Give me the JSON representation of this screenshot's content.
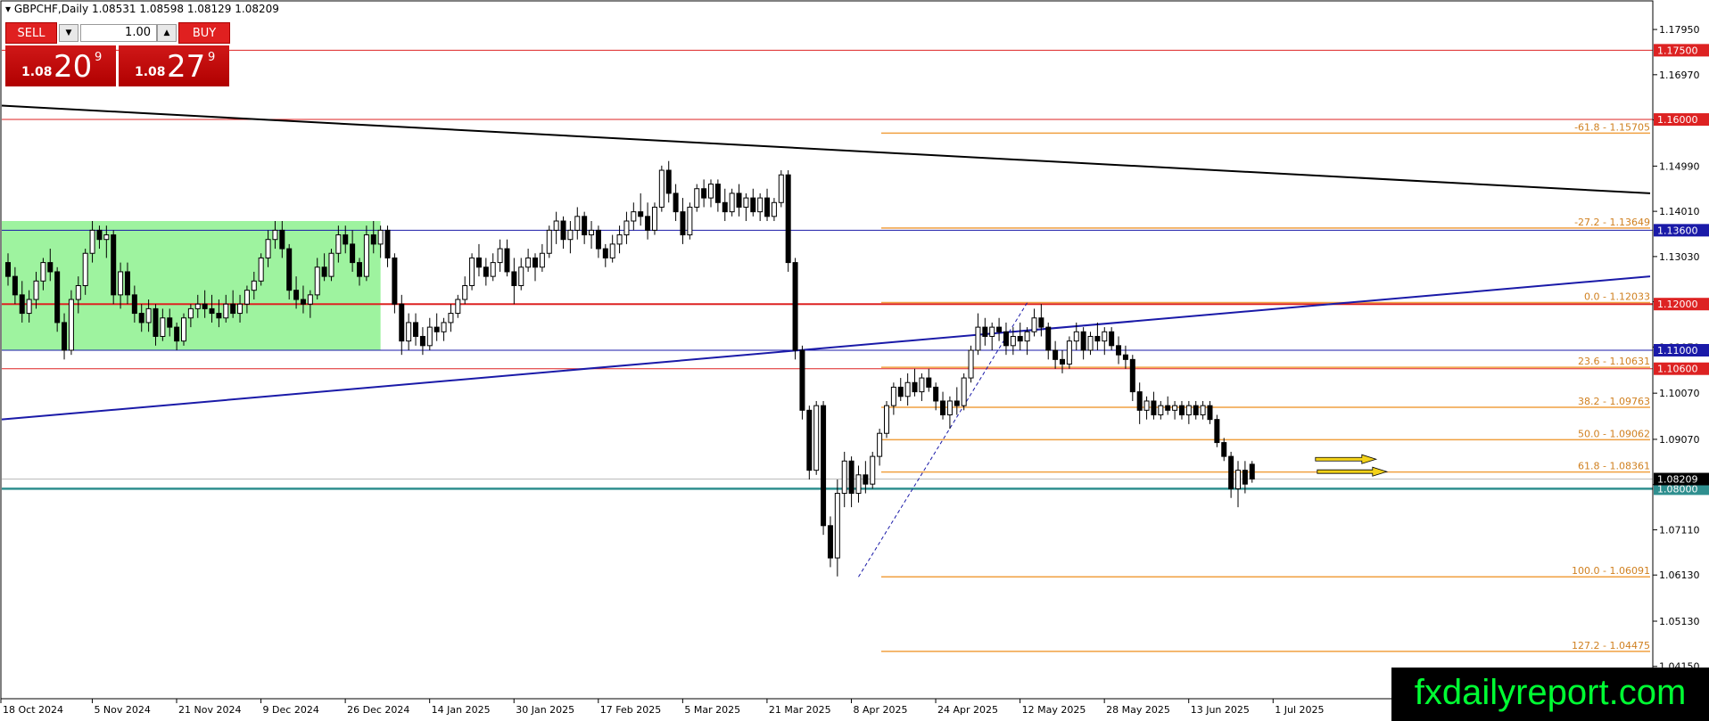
{
  "header": {
    "symbol": "GBPCHF,Daily",
    "ohlc": "1.08531 1.08598 1.08129 1.08209"
  },
  "trade_panel": {
    "sell_label": "SELL",
    "buy_label": "BUY",
    "lot": "1.00",
    "sell_prefix": "1.08",
    "sell_big": "20",
    "sell_sup": "9",
    "buy_prefix": "1.08",
    "buy_big": "27",
    "buy_sup": "9",
    "down_icon": "caret-down-icon",
    "up_icon": "caret-up-icon"
  },
  "watermark": "fxdailyreport.com",
  "colors": {
    "bull": "#ffffff",
    "bear": "#000000",
    "zone": "#99f29a",
    "fib": "#f0a040",
    "support": "#2f8f8f",
    "resistance": "#dd2222",
    "trend_blue": "#1a1aa8"
  },
  "chart_data": {
    "type": "candlestick",
    "ylim": [
      1.0345,
      1.1855
    ],
    "yticks": [
      "1.17950",
      "1.16970",
      "1.15990",
      "1.14990",
      "1.14010",
      "1.13030",
      "1.12050",
      "1.11070",
      "1.10070",
      "1.09070",
      "1.08090",
      "1.07110",
      "1.06130",
      "1.05130",
      "1.04150"
    ],
    "xticks": [
      "18 Oct 2024",
      "5 Nov 2024",
      "21 Nov 2024",
      "9 Dec 2024",
      "26 Dec 2024",
      "14 Jan 2025",
      "30 Jan 2025",
      "17 Feb 2025",
      "5 Mar 2025",
      "21 Mar 2025",
      "8 Apr 2025",
      "24 Apr 2025",
      "12 May 2025",
      "28 May 2025",
      "13 Jun 2025",
      "1 Jul 2025"
    ],
    "xtick_index": [
      0,
      13,
      25,
      37,
      49,
      61,
      73,
      85,
      97,
      109,
      121,
      133,
      145,
      157,
      169,
      181
    ],
    "bar_count": 186,
    "candles": [
      [
        1.129,
        1.131,
        1.124,
        1.126
      ],
      [
        1.126,
        1.128,
        1.12,
        1.122
      ],
      [
        1.122,
        1.125,
        1.116,
        1.118
      ],
      [
        1.118,
        1.123,
        1.116,
        1.121
      ],
      [
        1.121,
        1.127,
        1.119,
        1.125
      ],
      [
        1.125,
        1.13,
        1.123,
        1.129
      ],
      [
        1.129,
        1.132,
        1.125,
        1.127
      ],
      [
        1.127,
        1.128,
        1.114,
        1.116
      ],
      [
        1.116,
        1.118,
        1.108,
        1.11
      ],
      [
        1.11,
        1.123,
        1.109,
        1.121
      ],
      [
        1.121,
        1.126,
        1.118,
        1.124
      ],
      [
        1.124,
        1.132,
        1.122,
        1.131
      ],
      [
        1.131,
        1.138,
        1.129,
        1.136
      ],
      [
        1.136,
        1.137,
        1.132,
        1.134
      ],
      [
        1.134,
        1.137,
        1.13,
        1.135
      ],
      [
        1.135,
        1.136,
        1.12,
        1.122
      ],
      [
        1.122,
        1.129,
        1.119,
        1.127
      ],
      [
        1.127,
        1.129,
        1.12,
        1.122
      ],
      [
        1.122,
        1.124,
        1.116,
        1.118
      ],
      [
        1.118,
        1.12,
        1.114,
        1.116
      ],
      [
        1.116,
        1.121,
        1.114,
        1.119
      ],
      [
        1.119,
        1.12,
        1.111,
        1.113
      ],
      [
        1.113,
        1.119,
        1.112,
        1.117
      ],
      [
        1.117,
        1.119,
        1.113,
        1.115
      ],
      [
        1.115,
        1.116,
        1.11,
        1.112
      ],
      [
        1.112,
        1.118,
        1.111,
        1.117
      ],
      [
        1.117,
        1.12,
        1.115,
        1.119
      ],
      [
        1.119,
        1.122,
        1.117,
        1.12
      ],
      [
        1.12,
        1.123,
        1.117,
        1.119
      ],
      [
        1.119,
        1.122,
        1.116,
        1.118
      ],
      [
        1.118,
        1.121,
        1.115,
        1.117
      ],
      [
        1.117,
        1.122,
        1.116,
        1.12
      ],
      [
        1.12,
        1.123,
        1.117,
        1.118
      ],
      [
        1.118,
        1.122,
        1.116,
        1.12
      ],
      [
        1.12,
        1.124,
        1.118,
        1.123
      ],
      [
        1.123,
        1.127,
        1.121,
        1.125
      ],
      [
        1.125,
        1.131,
        1.124,
        1.13
      ],
      [
        1.13,
        1.136,
        1.128,
        1.134
      ],
      [
        1.134,
        1.138,
        1.132,
        1.136
      ],
      [
        1.136,
        1.138,
        1.13,
        1.132
      ],
      [
        1.132,
        1.133,
        1.121,
        1.123
      ],
      [
        1.123,
        1.126,
        1.119,
        1.121
      ],
      [
        1.121,
        1.124,
        1.118,
        1.12
      ],
      [
        1.12,
        1.123,
        1.117,
        1.122
      ],
      [
        1.122,
        1.13,
        1.121,
        1.128
      ],
      [
        1.128,
        1.131,
        1.125,
        1.126
      ],
      [
        1.126,
        1.132,
        1.125,
        1.131
      ],
      [
        1.131,
        1.137,
        1.129,
        1.135
      ],
      [
        1.135,
        1.137,
        1.131,
        1.133
      ],
      [
        1.133,
        1.136,
        1.127,
        1.129
      ],
      [
        1.129,
        1.13,
        1.124,
        1.126
      ],
      [
        1.126,
        1.137,
        1.125,
        1.135
      ],
      [
        1.135,
        1.138,
        1.131,
        1.133
      ],
      [
        1.133,
        1.137,
        1.13,
        1.136
      ],
      [
        1.136,
        1.137,
        1.128,
        1.13
      ],
      [
        1.13,
        1.131,
        1.118,
        1.12
      ],
      [
        1.12,
        1.122,
        1.109,
        1.112
      ],
      [
        1.112,
        1.118,
        1.11,
        1.116
      ],
      [
        1.116,
        1.118,
        1.111,
        1.113
      ],
      [
        1.113,
        1.115,
        1.109,
        1.111
      ],
      [
        1.111,
        1.117,
        1.11,
        1.115
      ],
      [
        1.115,
        1.118,
        1.112,
        1.114
      ],
      [
        1.114,
        1.117,
        1.112,
        1.116
      ],
      [
        1.116,
        1.12,
        1.114,
        1.118
      ],
      [
        1.118,
        1.122,
        1.117,
        1.121
      ],
      [
        1.121,
        1.126,
        1.12,
        1.124
      ],
      [
        1.124,
        1.131,
        1.123,
        1.13
      ],
      [
        1.13,
        1.133,
        1.126,
        1.128
      ],
      [
        1.128,
        1.13,
        1.124,
        1.126
      ],
      [
        1.126,
        1.131,
        1.125,
        1.129
      ],
      [
        1.129,
        1.134,
        1.127,
        1.132
      ],
      [
        1.132,
        1.134,
        1.126,
        1.127
      ],
      [
        1.127,
        1.13,
        1.12,
        1.124
      ],
      [
        1.124,
        1.13,
        1.123,
        1.128
      ],
      [
        1.128,
        1.132,
        1.127,
        1.13
      ],
      [
        1.13,
        1.131,
        1.125,
        1.128
      ],
      [
        1.128,
        1.133,
        1.127,
        1.131
      ],
      [
        1.131,
        1.137,
        1.13,
        1.136
      ],
      [
        1.136,
        1.14,
        1.133,
        1.138
      ],
      [
        1.138,
        1.139,
        1.132,
        1.134
      ],
      [
        1.134,
        1.138,
        1.131,
        1.136
      ],
      [
        1.136,
        1.141,
        1.134,
        1.139
      ],
      [
        1.139,
        1.14,
        1.133,
        1.135
      ],
      [
        1.135,
        1.138,
        1.132,
        1.136
      ],
      [
        1.136,
        1.137,
        1.13,
        1.132
      ],
      [
        1.132,
        1.133,
        1.128,
        1.13
      ],
      [
        1.13,
        1.135,
        1.129,
        1.133
      ],
      [
        1.133,
        1.137,
        1.131,
        1.135
      ],
      [
        1.135,
        1.14,
        1.133,
        1.138
      ],
      [
        1.138,
        1.142,
        1.136,
        1.14
      ],
      [
        1.14,
        1.144,
        1.137,
        1.139
      ],
      [
        1.139,
        1.142,
        1.134,
        1.136
      ],
      [
        1.136,
        1.142,
        1.135,
        1.141
      ],
      [
        1.141,
        1.15,
        1.14,
        1.149
      ],
      [
        1.149,
        1.151,
        1.142,
        1.144
      ],
      [
        1.144,
        1.146,
        1.138,
        1.14
      ],
      [
        1.14,
        1.143,
        1.133,
        1.135
      ],
      [
        1.135,
        1.142,
        1.134,
        1.141
      ],
      [
        1.141,
        1.146,
        1.14,
        1.145
      ],
      [
        1.145,
        1.147,
        1.141,
        1.143
      ],
      [
        1.143,
        1.147,
        1.141,
        1.146
      ],
      [
        1.146,
        1.147,
        1.14,
        1.142
      ],
      [
        1.142,
        1.145,
        1.138,
        1.14
      ],
      [
        1.14,
        1.145,
        1.139,
        1.144
      ],
      [
        1.144,
        1.146,
        1.139,
        1.141
      ],
      [
        1.141,
        1.144,
        1.138,
        1.143
      ],
      [
        1.143,
        1.145,
        1.139,
        1.14
      ],
      [
        1.14,
        1.144,
        1.138,
        1.143
      ],
      [
        1.143,
        1.145,
        1.138,
        1.139
      ],
      [
        1.139,
        1.143,
        1.138,
        1.142
      ],
      [
        1.142,
        1.149,
        1.141,
        1.148
      ],
      [
        1.148,
        1.149,
        1.127,
        1.129
      ],
      [
        1.129,
        1.13,
        1.108,
        1.11
      ],
      [
        1.11,
        1.111,
        1.095,
        1.097
      ],
      [
        1.097,
        1.098,
        1.082,
        1.084
      ],
      [
        1.084,
        1.099,
        1.083,
        1.098
      ],
      [
        1.098,
        1.099,
        1.07,
        1.072
      ],
      [
        1.072,
        1.074,
        1.063,
        1.065
      ],
      [
        1.065,
        1.082,
        1.061,
        1.079
      ],
      [
        1.079,
        1.088,
        1.076,
        1.086
      ],
      [
        1.086,
        1.087,
        1.076,
        1.079
      ],
      [
        1.079,
        1.085,
        1.077,
        1.083
      ],
      [
        1.083,
        1.086,
        1.079,
        1.081
      ],
      [
        1.081,
        1.088,
        1.08,
        1.087
      ],
      [
        1.087,
        1.093,
        1.085,
        1.092
      ],
      [
        1.092,
        1.099,
        1.091,
        1.098
      ],
      [
        1.098,
        1.103,
        1.096,
        1.102
      ],
      [
        1.102,
        1.104,
        1.099,
        1.1
      ],
      [
        1.1,
        1.105,
        1.098,
        1.103
      ],
      [
        1.103,
        1.106,
        1.1,
        1.101
      ],
      [
        1.101,
        1.105,
        1.099,
        1.104
      ],
      [
        1.104,
        1.106,
        1.101,
        1.102
      ],
      [
        1.102,
        1.103,
        1.097,
        1.099
      ],
      [
        1.099,
        1.101,
        1.095,
        1.096
      ],
      [
        1.096,
        1.1,
        1.093,
        1.099
      ],
      [
        1.099,
        1.102,
        1.096,
        1.098
      ],
      [
        1.098,
        1.105,
        1.097,
        1.104
      ],
      [
        1.104,
        1.111,
        1.103,
        1.11
      ],
      [
        1.11,
        1.118,
        1.109,
        1.115
      ],
      [
        1.115,
        1.117,
        1.111,
        1.113
      ],
      [
        1.113,
        1.116,
        1.11,
        1.115
      ],
      [
        1.115,
        1.117,
        1.112,
        1.114
      ],
      [
        1.114,
        1.116,
        1.109,
        1.111
      ],
      [
        1.111,
        1.115,
        1.109,
        1.113
      ],
      [
        1.113,
        1.116,
        1.11,
        1.112
      ],
      [
        1.112,
        1.115,
        1.109,
        1.114
      ],
      [
        1.114,
        1.119,
        1.113,
        1.117
      ],
      [
        1.117,
        1.12,
        1.113,
        1.115
      ],
      [
        1.115,
        1.116,
        1.108,
        1.11
      ],
      [
        1.11,
        1.112,
        1.106,
        1.108
      ],
      [
        1.108,
        1.11,
        1.105,
        1.107
      ],
      [
        1.107,
        1.113,
        1.106,
        1.112
      ],
      [
        1.112,
        1.116,
        1.11,
        1.114
      ],
      [
        1.114,
        1.115,
        1.108,
        1.11
      ],
      [
        1.11,
        1.114,
        1.109,
        1.113
      ],
      [
        1.113,
        1.116,
        1.11,
        1.112
      ],
      [
        1.112,
        1.115,
        1.109,
        1.114
      ],
      [
        1.114,
        1.115,
        1.11,
        1.111
      ],
      [
        1.111,
        1.113,
        1.107,
        1.109
      ],
      [
        1.109,
        1.111,
        1.106,
        1.108
      ],
      [
        1.108,
        1.109,
        1.099,
        1.101
      ],
      [
        1.101,
        1.103,
        1.094,
        1.097
      ],
      [
        1.097,
        1.1,
        1.095,
        1.099
      ],
      [
        1.099,
        1.101,
        1.095,
        1.096
      ],
      [
        1.096,
        1.099,
        1.095,
        1.098
      ],
      [
        1.098,
        1.1,
        1.096,
        1.097
      ],
      [
        1.097,
        1.099,
        1.095,
        1.098
      ],
      [
        1.098,
        1.099,
        1.095,
        1.096
      ],
      [
        1.096,
        1.099,
        1.094,
        1.098
      ],
      [
        1.098,
        1.099,
        1.095,
        1.096
      ],
      [
        1.096,
        1.099,
        1.095,
        1.098
      ],
      [
        1.098,
        1.099,
        1.094,
        1.095
      ],
      [
        1.095,
        1.096,
        1.089,
        1.09
      ],
      [
        1.09,
        1.091,
        1.086,
        1.087
      ],
      [
        1.087,
        1.088,
        1.078,
        1.08
      ],
      [
        1.08,
        1.086,
        1.076,
        1.084
      ],
      [
        1.084,
        1.086,
        1.079,
        1.081
      ],
      [
        1.0853,
        1.086,
        1.0813,
        1.0821
      ]
    ],
    "horizontal_levels": [
      {
        "label": "1.17500",
        "value": 1.175,
        "color": "#dd2222"
      },
      {
        "label": "1.16000",
        "value": 1.16,
        "color": "#dd2222"
      },
      {
        "label": "1.13600",
        "value": 1.136,
        "color": "#1a1aa8"
      },
      {
        "label": "1.12000",
        "value": 1.12,
        "color": "#dd2222"
      },
      {
        "label": "1.11000",
        "value": 1.11,
        "color": "#1a1aa8"
      },
      {
        "label": "1.10600",
        "value": 1.106,
        "color": "#dd2222"
      },
      {
        "label": "1.08000",
        "value": 1.08,
        "color": "#2f8f8f"
      }
    ],
    "current_price": {
      "label": "1.08209",
      "value": 1.08209
    },
    "fib_levels": [
      {
        "label": "-61.8 - 1.15705",
        "value": 1.15705
      },
      {
        "label": "-27.2 - 1.13649",
        "value": 1.13649
      },
      {
        "label": "0.0 - 1.12033",
        "value": 1.12033
      },
      {
        "label": "23.6 - 1.10631",
        "value": 1.10631
      },
      {
        "label": "38.2 - 1.09763",
        "value": 1.09763
      },
      {
        "label": "50.0 - 1.09062",
        "value": 1.09062
      },
      {
        "label": "61.8 - 1.08361",
        "value": 1.08361
      },
      {
        "label": "100.0 - 1.06091",
        "value": 1.06091
      },
      {
        "label": "127.2 - 1.04475",
        "value": 1.04475
      }
    ],
    "grid": false
  }
}
